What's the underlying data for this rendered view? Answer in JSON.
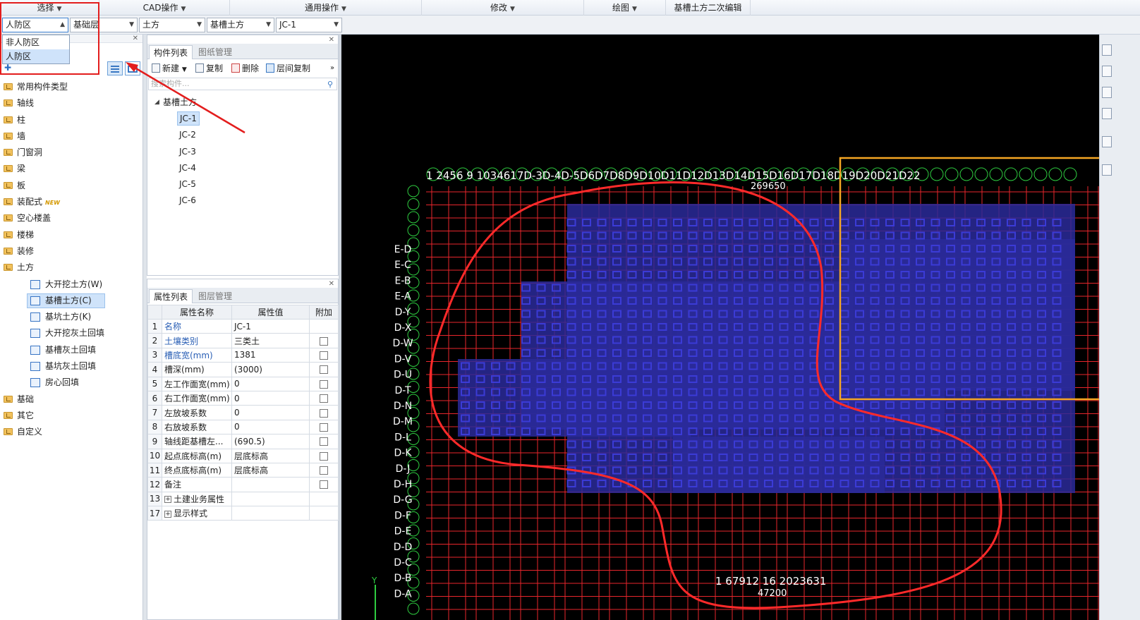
{
  "menu": {
    "items": [
      {
        "label": "选择",
        "has_caret": true
      },
      {
        "label": "CAD操作",
        "has_caret": true
      },
      {
        "label": "通用操作",
        "has_caret": true
      },
      {
        "label": "修改",
        "has_caret": true
      },
      {
        "label": "绘图",
        "has_caret": true
      },
      {
        "label": "基槽土方二次编辑",
        "has_caret": false
      }
    ]
  },
  "selectors": {
    "region": "人防区",
    "floor": "基础层",
    "category": "土方",
    "type": "基槽土方",
    "component": "JC-1"
  },
  "region_dropdown": {
    "options": [
      "非人防区",
      "人防区"
    ],
    "selected": "人防区"
  },
  "nav": {
    "items": [
      {
        "label": "常用构件类型"
      },
      {
        "label": "轴线"
      },
      {
        "label": "柱"
      },
      {
        "label": "墙"
      },
      {
        "label": "门窗洞"
      },
      {
        "label": "梁"
      },
      {
        "label": "板"
      },
      {
        "label": "装配式",
        "badge": "NEW"
      },
      {
        "label": "空心楼盖"
      },
      {
        "label": "楼梯"
      },
      {
        "label": "装修"
      },
      {
        "label": "土方"
      },
      {
        "label": "基础"
      },
      {
        "label": "其它"
      },
      {
        "label": "自定义"
      }
    ],
    "earthwork_children": [
      {
        "label": "大开挖土方(W)"
      },
      {
        "label": "基槽土方(C)",
        "active": true
      },
      {
        "label": "基坑土方(K)"
      },
      {
        "label": "大开挖灰土回填"
      },
      {
        "label": "基槽灰土回填"
      },
      {
        "label": "基坑灰土回填"
      },
      {
        "label": "房心回填"
      }
    ]
  },
  "component_panel": {
    "tabs": [
      "构件列表",
      "图纸管理"
    ],
    "toolbar": {
      "new": "新建",
      "copy": "复制",
      "delete": "删除",
      "floor_copy": "层间复制"
    },
    "search_placeholder": "搜索构件...",
    "tree_root": "基槽土方",
    "items": [
      "JC-1",
      "JC-2",
      "JC-3",
      "JC-4",
      "JC-5",
      "JC-6"
    ],
    "selected": "JC-1"
  },
  "property_panel": {
    "tabs": [
      "属性列表",
      "图层管理"
    ],
    "columns": [
      "属性名称",
      "属性值",
      "附加"
    ],
    "rows": [
      {
        "num": "1",
        "name": "名称",
        "value": "JC-1",
        "blue": true,
        "checkbox": false
      },
      {
        "num": "2",
        "name": "土壤类别",
        "value": "三类土",
        "blue": true,
        "checkbox": true
      },
      {
        "num": "3",
        "name": "槽底宽(mm)",
        "value": "1381",
        "blue": true,
        "checkbox": true
      },
      {
        "num": "4",
        "name": "槽深(mm)",
        "value": "(3000)",
        "blue": false,
        "checkbox": true
      },
      {
        "num": "5",
        "name": "左工作面宽(mm)",
        "value": "0",
        "blue": false,
        "checkbox": true
      },
      {
        "num": "6",
        "name": "右工作面宽(mm)",
        "value": "0",
        "blue": false,
        "checkbox": true
      },
      {
        "num": "7",
        "name": "左放坡系数",
        "value": "0",
        "blue": false,
        "checkbox": true
      },
      {
        "num": "8",
        "name": "右放坡系数",
        "value": "0",
        "blue": false,
        "checkbox": true
      },
      {
        "num": "9",
        "name": "轴线距基槽左...",
        "value": "(690.5)",
        "blue": false,
        "checkbox": true
      },
      {
        "num": "10",
        "name": "起点底标高(m)",
        "value": "层底标高",
        "blue": false,
        "checkbox": true
      },
      {
        "num": "11",
        "name": "终点底标高(m)",
        "value": "层底标高",
        "blue": false,
        "checkbox": true
      },
      {
        "num": "12",
        "name": "备注",
        "value": "",
        "blue": false,
        "checkbox": true
      },
      {
        "num": "13",
        "name": "土建业务属性",
        "value": "",
        "blue": false,
        "checkbox": false,
        "expand": true
      },
      {
        "num": "17",
        "name": "显示样式",
        "value": "",
        "blue": false,
        "checkbox": false,
        "expand": true
      }
    ]
  },
  "cad": {
    "top_axis_text": "1 2456 9 1034617D-3D-4D-5D6D7D8D9D10D11D12D13D14D15D16D17D18D19D20D21D22",
    "left_axis_labels": [
      "E-D",
      "E-C",
      "E-B",
      "E-A",
      "D-Y",
      "D-X",
      "D-W",
      "D-V",
      "D-U",
      "D-T",
      "D-N",
      "D-M",
      "D-L",
      "D-K",
      "D-J",
      "D-H",
      "D-G",
      "D-F",
      "D-E",
      "D-D",
      "D-C",
      "D-B",
      "D-A"
    ],
    "bottom_axis_text": "1 67912 16 2023631",
    "dimension_text": "269650",
    "bottom_dimension_text": "47200",
    "colors": {
      "grid": "#e8262c",
      "component": "#3b3bd6",
      "fill": "#2a2a9a",
      "highlight_box": "#f5a623",
      "annotation": "#ff2a2a",
      "axis_circle": "#2ecc40"
    }
  }
}
